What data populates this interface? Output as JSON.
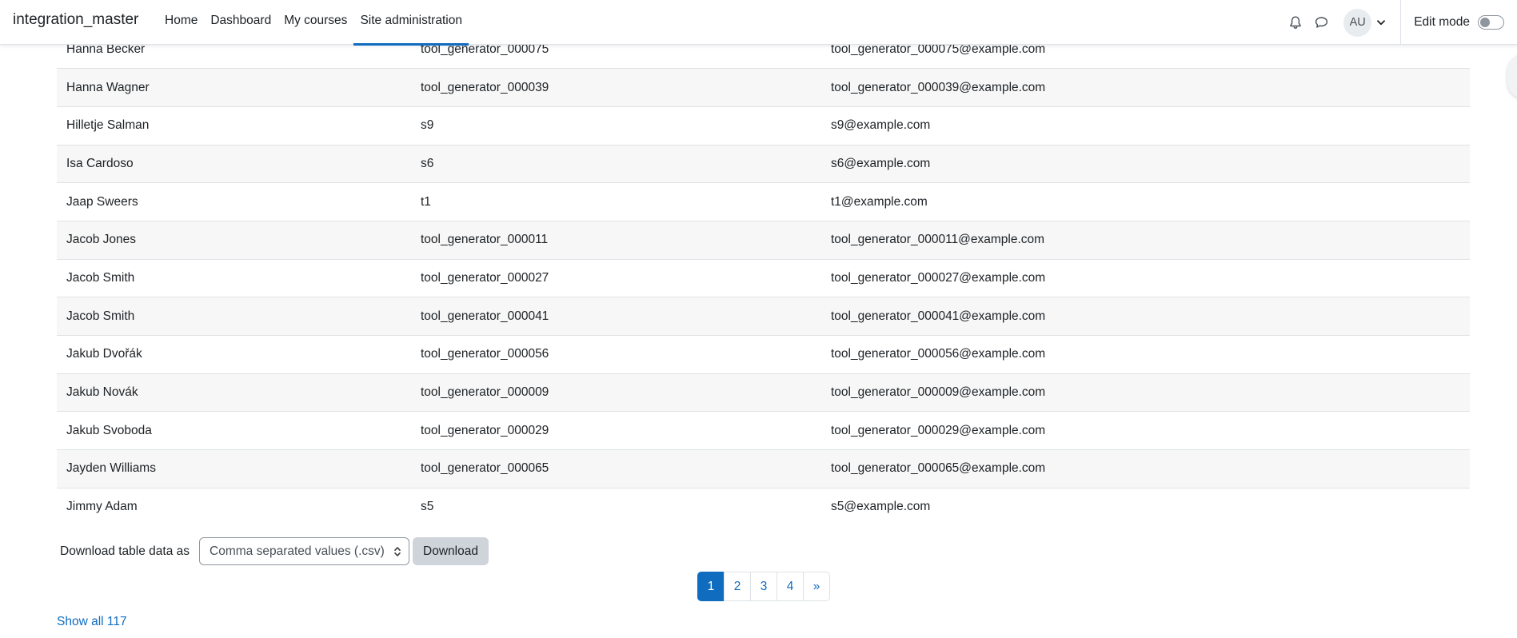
{
  "header": {
    "site_name": "integration_master",
    "nav": [
      {
        "label": "Home"
      },
      {
        "label": "Dashboard"
      },
      {
        "label": "My courses"
      },
      {
        "label": "Site administration"
      }
    ],
    "active_nav": "Site administration",
    "user_initials": "AU",
    "edit_mode_label": "Edit mode",
    "edit_mode_on": false,
    "icons": {
      "notifications": "bell-icon",
      "messages": "chat-bubble-icon",
      "user_menu": "chevron-down-icon"
    }
  },
  "table": {
    "rows": [
      {
        "name": "Hanna Becker",
        "username": "tool_generator_000075",
        "email": "tool_generator_000075@example.com"
      },
      {
        "name": "Hanna Wagner",
        "username": "tool_generator_000039",
        "email": "tool_generator_000039@example.com"
      },
      {
        "name": "Hilletje Salman",
        "username": "s9",
        "email": "s9@example.com"
      },
      {
        "name": "Isa Cardoso",
        "username": "s6",
        "email": "s6@example.com"
      },
      {
        "name": "Jaap Sweers",
        "username": "t1",
        "email": "t1@example.com"
      },
      {
        "name": "Jacob Jones",
        "username": "tool_generator_000011",
        "email": "tool_generator_000011@example.com"
      },
      {
        "name": "Jacob Smith",
        "username": "tool_generator_000027",
        "email": "tool_generator_000027@example.com"
      },
      {
        "name": "Jacob Smith",
        "username": "tool_generator_000041",
        "email": "tool_generator_000041@example.com"
      },
      {
        "name": "Jakub Dvořák",
        "username": "tool_generator_000056",
        "email": "tool_generator_000056@example.com"
      },
      {
        "name": "Jakub Novák",
        "username": "tool_generator_000009",
        "email": "tool_generator_000009@example.com"
      },
      {
        "name": "Jakub Svoboda",
        "username": "tool_generator_000029",
        "email": "tool_generator_000029@example.com"
      },
      {
        "name": "Jayden Williams",
        "username": "tool_generator_000065",
        "email": "tool_generator_000065@example.com"
      },
      {
        "name": "Jimmy Adam",
        "username": "s5",
        "email": "s5@example.com"
      }
    ]
  },
  "download": {
    "label": "Download table data as",
    "selected_format": "Comma separated values (.csv)",
    "button_label": "Download"
  },
  "pagination": {
    "pages": [
      "1",
      "2",
      "3",
      "4"
    ],
    "current": "1",
    "next_label": "»"
  },
  "show_all_label": "Show all 117",
  "colors": {
    "primary": "#0f6cbf",
    "border": "#dee2e6",
    "row_stripe": "#f7f7f7",
    "secondary_button": "#ced4da"
  }
}
